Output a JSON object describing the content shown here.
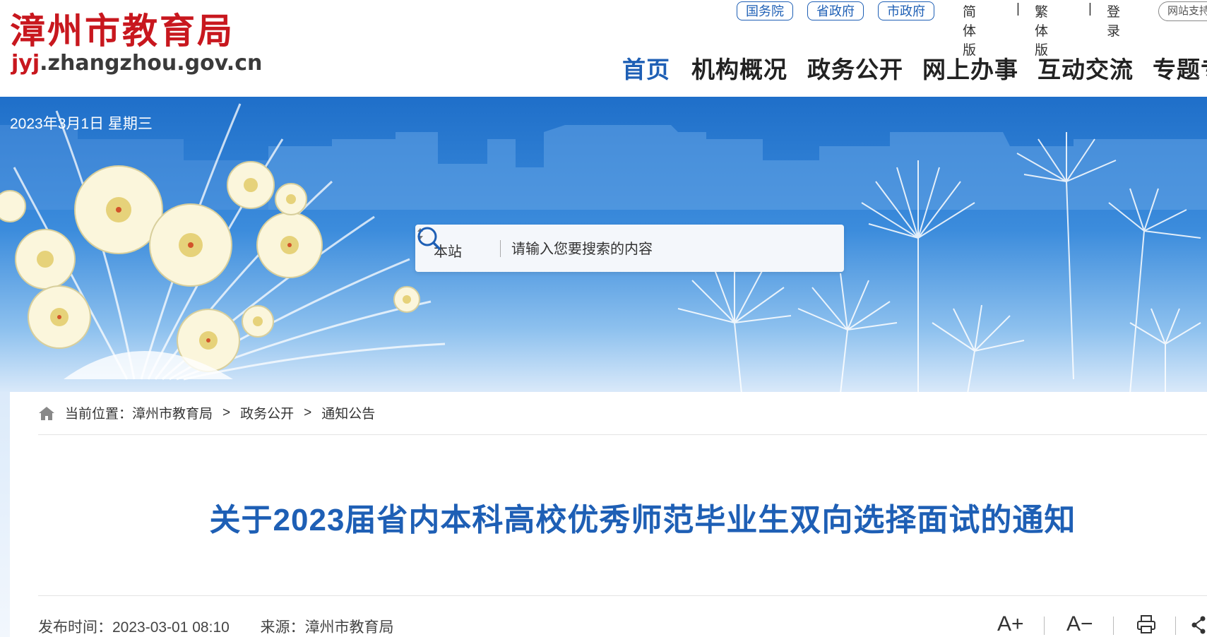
{
  "header": {
    "logo_text": "漳州市教育局",
    "logo_url_prefix": "jyj",
    "logo_url_rest": ".zhangzhou.gov.cn",
    "top_links": [
      "国务院",
      "省政府",
      "市政府"
    ],
    "version_links": [
      "简体版",
      "繁体版",
      "登录"
    ],
    "separator": "|",
    "support_label": "网站支持"
  },
  "nav": {
    "items": [
      "首页",
      "机构概况",
      "政务公开",
      "网上办事",
      "互动交流",
      "专题专栏"
    ],
    "active_index": 0
  },
  "banner": {
    "date": "2023年3月1日 星期三"
  },
  "search": {
    "scope": "本站",
    "placeholder": "请输入您要搜索的内容"
  },
  "breadcrumb": {
    "label": "当前位置：",
    "items": [
      "漳州市教育局",
      "政务公开",
      "通知公告"
    ],
    "separator": ">"
  },
  "article": {
    "title": "关于2023届省内本科高校优秀师范毕业生双向选择面试的通知",
    "publish_label": "发布时间：",
    "publish_time": "2023-03-01 08:10",
    "source_label": "来源：",
    "source": "漳州市教育局"
  },
  "tools": {
    "font_increase": "A+",
    "font_decrease": "A−"
  },
  "colors": {
    "brand_red": "#c8171e",
    "accent_blue": "#1e5fb5"
  }
}
